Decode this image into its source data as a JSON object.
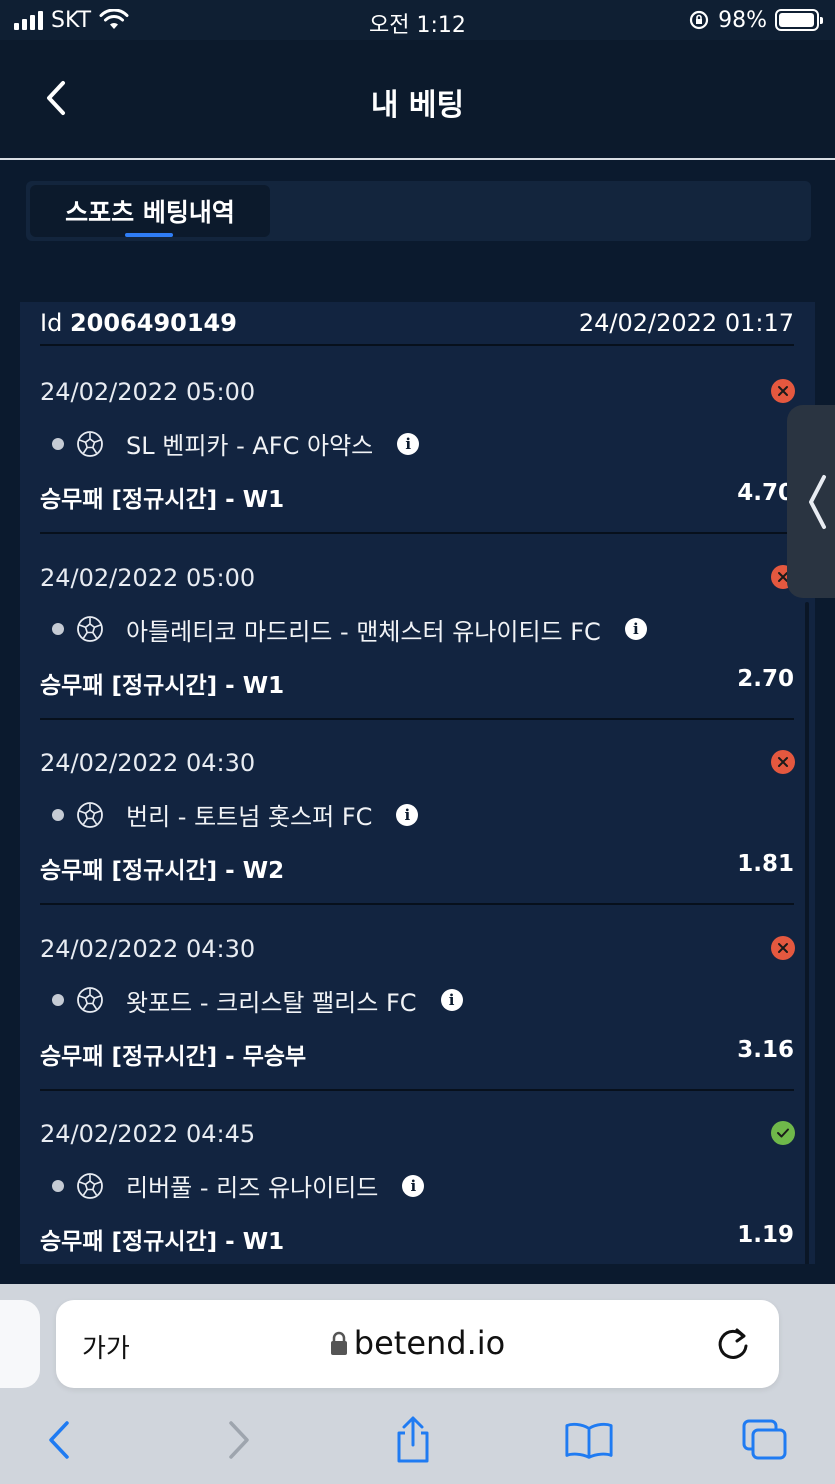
{
  "status_bar": {
    "carrier": "SKT",
    "time": "오전 1:12",
    "battery": "98%",
    "battery_level": 0.98
  },
  "header": {
    "title": "내 베팅",
    "back_icon": "chevron-left-icon"
  },
  "tabs": [
    {
      "label": "스포츠 베팅내역",
      "active": true
    }
  ],
  "bet_slip": {
    "id_label": "Id",
    "id_value": "2006490149",
    "placed_at": "24/02/2022 01:17",
    "selections": [
      {
        "time": "24/02/2022 05:00",
        "match": "SL 벤피카 - AFC 아약스",
        "market": "승무패 [정규시간] - W1",
        "odds": "4.70",
        "result": "lost"
      },
      {
        "time": "24/02/2022 05:00",
        "match": "아틀레티코 마드리드 - 맨체스터 유나이티드 FC",
        "market": "승무패 [정규시간] - W1",
        "odds": "2.70",
        "result": "lost"
      },
      {
        "time": "24/02/2022 04:30",
        "match": "번리 - 토트넘 홋스퍼 FC",
        "market": "승무패 [정규시간] - W2",
        "odds": "1.81",
        "result": "lost"
      },
      {
        "time": "24/02/2022 04:30",
        "match": "왓포드 - 크리스탈 팰리스 FC",
        "market": "승무패 [정규시간] - 무승부",
        "odds": "3.16",
        "result": "lost"
      },
      {
        "time": "24/02/2022 04:45",
        "match": "리버풀 - 리즈 유나이티드",
        "market": "승무패 [정규시간] - W1",
        "odds": "1.19",
        "result": "won"
      }
    ]
  },
  "browser": {
    "text_size_label": "가가",
    "url": "betend.io"
  },
  "colors": {
    "background": "#0b1a2e",
    "card": "#122440",
    "accent": "#2f7df6",
    "lost": "#e4583f",
    "won": "#6fb84a"
  }
}
